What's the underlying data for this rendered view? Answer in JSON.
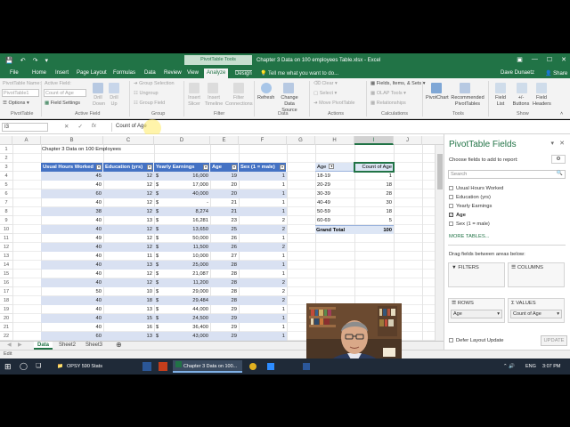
{
  "window": {
    "title": "Chapter 3 Data on 100 employees Table.xlsx - Excel",
    "context_tab_title": "PivotTable Tools"
  },
  "tabs": [
    "File",
    "Home",
    "Insert",
    "Page Layout",
    "Formulas",
    "Data",
    "Review",
    "View",
    "Analyze",
    "Design"
  ],
  "active_tab": "Analyze",
  "tell_me": "Tell me what you want to do...",
  "user": "Dave Dunaetz",
  "share": "Share",
  "ribbon": {
    "pivottable_name_label": "PivotTable Name:",
    "pivottable_name_value": "PivotTable1",
    "options_label": "Options",
    "active_field_label": "Active Field:",
    "active_field_value": "Count of Age",
    "field_settings_label": "Field Settings",
    "drill_down": "Drill Down",
    "drill_up": "Drill Up",
    "group_selection": "Group Selection",
    "ungroup": "Ungroup",
    "group_field": "Group Field",
    "insert_slicer": "Insert Slicer",
    "insert_timeline": "Insert Timeline",
    "filter_connections": "Filter Connections",
    "refresh": "Refresh",
    "change_data_source": "Change Data Source",
    "clear": "Clear",
    "select": "Select",
    "move_pivottable": "Move PivotTable",
    "fields_items_sets": "Fields, Items, & Sets",
    "olap_tools": "OLAP Tools",
    "relationships": "Relationships",
    "pivotchart": "PivotChart",
    "recommended_pivottables": "Recommended PivotTables",
    "field_list": "Field List",
    "buttons": "+/- Buttons",
    "field_headers": "Field Headers",
    "groups": [
      "PivotTable",
      "Active Field",
      "Group",
      "Filter",
      "Data",
      "Actions",
      "Calculations",
      "Tools",
      "Show"
    ]
  },
  "formula_bar": {
    "name_box": "I3",
    "content": "Count of Age"
  },
  "columns": [
    "A",
    "B",
    "C",
    "D",
    "E",
    "F",
    "G",
    "H",
    "I",
    "J"
  ],
  "rows": [
    "1",
    "2",
    "3",
    "4",
    "5",
    "6",
    "7",
    "8",
    "9",
    "10",
    "11",
    "12",
    "13",
    "14",
    "15",
    "16",
    "17",
    "18",
    "19",
    "20",
    "21",
    "22",
    "23"
  ],
  "sheet": {
    "title": "Chapter 3 Data on 100 Employees",
    "headers": [
      "Usual Hours Worked",
      "Education (yrs)",
      "Yearly Earnings",
      "Age",
      "Sex (1 = male)"
    ],
    "currency": "$",
    "data": [
      [
        "45",
        "12",
        "16,000",
        "19",
        "1"
      ],
      [
        "40",
        "12",
        "17,000",
        "20",
        "1"
      ],
      [
        "60",
        "12",
        "40,000",
        "20",
        "1"
      ],
      [
        "40",
        "12",
        "-",
        "21",
        "1"
      ],
      [
        "38",
        "12",
        "8,274",
        "21",
        "1"
      ],
      [
        "40",
        "13",
        "16,281",
        "23",
        "2"
      ],
      [
        "40",
        "12",
        "13,650",
        "25",
        "2"
      ],
      [
        "49",
        "12",
        "50,000",
        "26",
        "1"
      ],
      [
        "40",
        "12",
        "11,500",
        "26",
        "2"
      ],
      [
        "40",
        "11",
        "10,000",
        "27",
        "1"
      ],
      [
        "40",
        "13",
        "25,000",
        "28",
        "1"
      ],
      [
        "40",
        "12",
        "21,087",
        "28",
        "1"
      ],
      [
        "40",
        "12",
        "11,200",
        "28",
        "2"
      ],
      [
        "50",
        "10",
        "29,000",
        "28",
        "2"
      ],
      [
        "40",
        "18",
        "29,484",
        "28",
        "2"
      ],
      [
        "40",
        "13",
        "44,000",
        "29",
        "1"
      ],
      [
        "40",
        "15",
        "24,500",
        "29",
        "1"
      ],
      [
        "40",
        "16",
        "36,400",
        "29",
        "1"
      ],
      [
        "60",
        "13",
        "43,000",
        "29",
        "1"
      ],
      [
        "40",
        "13",
        "48,200",
        "30",
        "1"
      ]
    ]
  },
  "pivot": {
    "row_header": "Age",
    "value_header": "Count of Age",
    "rows": [
      {
        "label": "18-19",
        "value": "1"
      },
      {
        "label": "20-29",
        "value": "18"
      },
      {
        "label": "30-39",
        "value": "28"
      },
      {
        "label": "40-49",
        "value": "30"
      },
      {
        "label": "50-59",
        "value": "18"
      },
      {
        "label": "60-69",
        "value": "5"
      }
    ],
    "total_label": "Grand Total",
    "total_value": "100"
  },
  "sheet_tabs": [
    "Data",
    "Sheet2",
    "Sheet3"
  ],
  "active_sheet": "Data",
  "status": {
    "mode": "Edit"
  },
  "pivot_panel": {
    "title": "PivotTable Fields",
    "choose_label": "Choose fields to add to report:",
    "search_placeholder": "Search",
    "fields": [
      {
        "name": "Usual Hours Worked",
        "checked": false
      },
      {
        "name": "Education (yrs)",
        "checked": false
      },
      {
        "name": "Yearly Earnings",
        "checked": false
      },
      {
        "name": "Age",
        "checked": true
      },
      {
        "name": "Sex (1 = male)",
        "checked": false
      }
    ],
    "more_tables": "MORE TABLES...",
    "drag_label": "Drag fields between areas below:",
    "filters": "FILTERS",
    "columns": "COLUMNS",
    "rows": "ROWS",
    "values": "VALUES",
    "rows_item": "Age",
    "values_item": "Count of Age",
    "defer_label": "Defer Layout Update",
    "update_button": "UPDATE"
  },
  "taskbar": {
    "items": [
      "OPSY 590 Stats",
      "Chapter 3 Data on 100..."
    ],
    "lang": "ENG",
    "time": "3:07 PM"
  }
}
